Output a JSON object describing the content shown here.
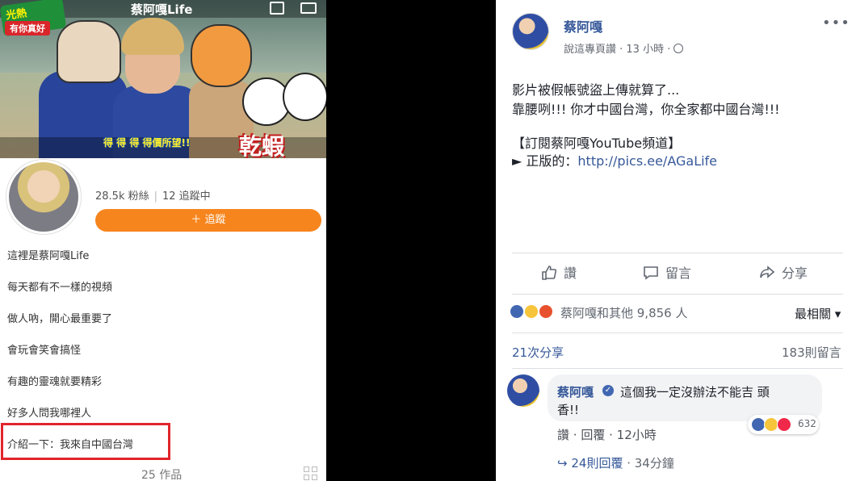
{
  "left_panel": {
    "header_title": "蔡阿嘎Life",
    "banner": {
      "logo_top": "光熱",
      "logo_sub": "有你真好",
      "caption": "得 得 得 得價所望!!",
      "big_text": "乾蝦"
    },
    "stats": {
      "fans": "28.5k 粉絲",
      "following": "12 追蹤中"
    },
    "follow_button": "＋ 追蹤",
    "bio_lines": [
      "這裡是蔡阿嘎Life",
      "每天都有不一樣的視頻",
      "做人吶，開心最重要了",
      "會玩會笑會搞怪",
      "有趣的靈魂就要精彩",
      "好多人問我哪裡人",
      "介紹一下：我來自中國台灣"
    ],
    "works": "25 作品",
    "colors": {
      "follow": "#f7851e",
      "highlight": "#e1252b"
    }
  },
  "right_panel": {
    "poster_name": "蔡阿嘎",
    "meta": "說這專頁讚 · 13 小時 · ",
    "post_lines": [
      "影片被假帳號盜上傳就算了...",
      "靠腰咧!!! 你才中國台灣，你全家都中國台灣!!!",
      "【訂閱蔡阿嘎YouTube頻道】",
      "► 正版的："
    ],
    "post_link": "http://pics.ee/AGaLife",
    "actions": {
      "like": "讚",
      "comment": "留言",
      "share": "分享"
    },
    "reaction_names": "蔡阿嘎和其他 9,856 人",
    "sort_label": "最相關 ▾",
    "shares": "21次分享",
    "comment_count": "183則留言",
    "comment": {
      "author": "蔡阿嘎",
      "text_line1": "這個我一定沒辦法不能吉 頭",
      "text_line2": "香!!",
      "reaction_count": "632",
      "like": "讚",
      "reply": "回覆",
      "time": "12小時",
      "replies": "24則回覆",
      "replies_time": " · 34分鐘"
    },
    "colors": {
      "link": "#365899",
      "like_blue": "#4267b2",
      "haha": "#f7c53b",
      "angry": "#e8512d",
      "love": "#f0284a"
    }
  }
}
